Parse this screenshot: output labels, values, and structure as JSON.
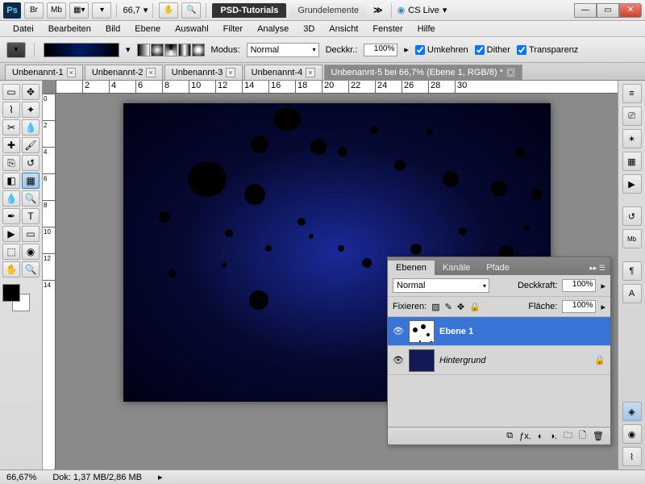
{
  "title": {
    "zoom": "66,7",
    "workspace1": "PSD-Tutorials",
    "workspace2": "Grundelemente",
    "cslive": "CS Live"
  },
  "topbtn": {
    "br": "Br",
    "mb": "Mb"
  },
  "menu": [
    "Datei",
    "Bearbeiten",
    "Bild",
    "Ebene",
    "Auswahl",
    "Filter",
    "Analyse",
    "3D",
    "Ansicht",
    "Fenster",
    "Hilfe"
  ],
  "optbar": {
    "mode_label": "Modus:",
    "mode_value": "Normal",
    "opacity_label": "Deckkr.:",
    "opacity_value": "100%",
    "reverse": "Umkehren",
    "dither": "Dither",
    "transparency": "Transparenz"
  },
  "doctabs": [
    {
      "label": "Unbenannt-1"
    },
    {
      "label": "Unbenannt-2"
    },
    {
      "label": "Unbenannt-3"
    },
    {
      "label": "Unbenannt-4"
    },
    {
      "label": "Unbenannt-5 bei 66,7% (Ebene 1, RGB/8) *"
    }
  ],
  "ruler_h": [
    "",
    "2",
    "4",
    "6",
    "8",
    "10",
    "12",
    "14",
    "16",
    "18",
    "20",
    "22",
    "24",
    "26",
    "28",
    "30"
  ],
  "ruler_v": [
    "0",
    "2",
    "4",
    "6",
    "8",
    "10",
    "12",
    "14"
  ],
  "status": {
    "zoom": "66,67%",
    "doc": "Dok: 1,37 MB/2,86 MB"
  },
  "layers": {
    "tabs": [
      "Ebenen",
      "Kanäle",
      "Pfade"
    ],
    "blend": "Normal",
    "opacity_label": "Deckkraft:",
    "opacity_value": "100%",
    "lock_label": "Fixieren:",
    "fill_label": "Fläche:",
    "fill_value": "100%",
    "items": [
      {
        "name": "Ebene 1"
      },
      {
        "name": "Hintergrund"
      }
    ]
  }
}
